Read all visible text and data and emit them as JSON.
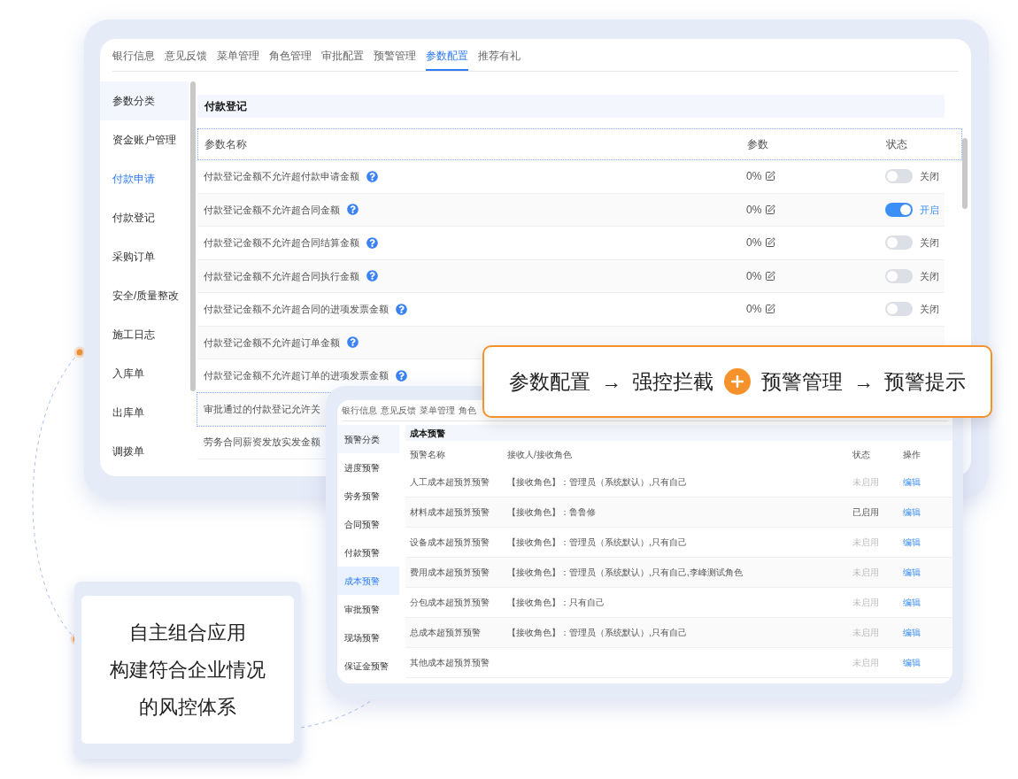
{
  "main_window": {
    "tabs": [
      {
        "label": "银行信息",
        "selected": false
      },
      {
        "label": "意见反馈",
        "selected": false
      },
      {
        "label": "菜单管理",
        "selected": false
      },
      {
        "label": "角色管理",
        "selected": false
      },
      {
        "label": "审批配置",
        "selected": false
      },
      {
        "label": "预警管理",
        "selected": false
      },
      {
        "label": "参数配置",
        "selected": true
      },
      {
        "label": "推荐有礼",
        "selected": false
      }
    ],
    "sidebar": {
      "header": "参数分类",
      "items": [
        {
          "label": "资金账户管理",
          "selected": false
        },
        {
          "label": "付款申请",
          "selected": true
        },
        {
          "label": "付款登记",
          "selected": false
        },
        {
          "label": "采购订单",
          "selected": false
        },
        {
          "label": "安全/质量整改",
          "selected": false
        },
        {
          "label": "施工日志",
          "selected": false
        },
        {
          "label": "入库单",
          "selected": false
        },
        {
          "label": "出库单",
          "selected": false
        },
        {
          "label": "调拨单",
          "selected": false
        }
      ]
    },
    "section_title": "付款登记",
    "columns": [
      "参数名称",
      "参数",
      "状态"
    ],
    "rows": [
      {
        "name": "付款登记金额不允许超付款申请金额",
        "focused": false,
        "param": "0%",
        "on": false,
        "status": "关闭"
      },
      {
        "name": "付款登记金额不允许超合同金额",
        "focused": false,
        "param": "0%",
        "on": true,
        "status": "开启"
      },
      {
        "name": "付款登记金额不允许超合同结算金额",
        "focused": false,
        "param": "0%",
        "on": false,
        "status": "关闭"
      },
      {
        "name": "付款登记金额不允许超合同执行金额",
        "focused": false,
        "param": "0%",
        "on": false,
        "status": "关闭"
      },
      {
        "name": "付款登记金额不允许超合同的进项发票金额",
        "focused": false,
        "param": "0%",
        "on": false,
        "status": "关闭"
      },
      {
        "name": "付款登记金额不允许超订单金额",
        "focused": false
      },
      {
        "name": "付款登记金额不允许超订单的进项发票金额",
        "focused": false
      }
    ],
    "cut_rows": [
      {
        "name": "审批通过的付款登记允许关",
        "focused": true
      },
      {
        "name": "劳务合同薪资发放实发金额",
        "focused": false
      }
    ]
  },
  "callout": {
    "parts": [
      {
        "kind": "text",
        "text": "参数配置"
      },
      {
        "kind": "arrow",
        "text": "→"
      },
      {
        "kind": "text",
        "text": "强控拦截"
      },
      {
        "kind": "plus"
      },
      {
        "kind": "text",
        "text": "预警管理"
      },
      {
        "kind": "arrow",
        "text": "→"
      },
      {
        "kind": "text",
        "text": "预警提示"
      }
    ]
  },
  "warning_window": {
    "tabs": [
      "银行信息",
      "意见反馈",
      "菜单管理",
      "角色"
    ],
    "sidebar": {
      "header": "预警分类",
      "items": [
        {
          "label": "进度预警",
          "selected": false
        },
        {
          "label": "劳务预警",
          "selected": false
        },
        {
          "label": "合同预警",
          "selected": false
        },
        {
          "label": "付款预警",
          "selected": false
        },
        {
          "label": "成本预警",
          "selected": true
        },
        {
          "label": "审批预警",
          "selected": false
        },
        {
          "label": "现场预警",
          "selected": false
        },
        {
          "label": "保证金预警",
          "selected": false
        }
      ]
    },
    "section_title": "成本预警",
    "columns": [
      "预警名称",
      "接收人/接收角色",
      "状态",
      "操作"
    ],
    "rows": [
      {
        "name": "人工成本超预算预警",
        "receiver": "【接收角色】：管理员（系统默认）,只有自己",
        "status": "未启用",
        "enabled": false,
        "action": "编辑"
      },
      {
        "name": "材料成本超预算预警",
        "receiver": "【接收角色】：鲁鲁修",
        "status": "已启用",
        "enabled": true,
        "action": "编辑"
      },
      {
        "name": "设备成本超预算预警",
        "receiver": "【接收角色】：管理员（系统默认）,只有自己",
        "status": "未启用",
        "enabled": false,
        "action": "编辑"
      },
      {
        "name": "费用成本超预算预警",
        "receiver": "【接收角色】：管理员（系统默认）,只有自己,李峰测试角色",
        "status": "未启用",
        "enabled": false,
        "action": "编辑"
      },
      {
        "name": "分包成本超预算预警",
        "receiver": "【接收角色】：只有自己",
        "status": "未启用",
        "enabled": false,
        "action": "编辑"
      },
      {
        "name": "总成本超预算预警",
        "receiver": "【接收角色】：管理员（系统默认）,只有自己",
        "status": "未启用",
        "enabled": false,
        "action": "编辑"
      },
      {
        "name": "其他成本超预算预警",
        "status": "未启用",
        "enabled": false,
        "action": "编辑"
      }
    ]
  },
  "feature_card": {
    "lines": [
      "自主组合应用",
      "构建符合企业情况",
      "的风控体系"
    ]
  }
}
